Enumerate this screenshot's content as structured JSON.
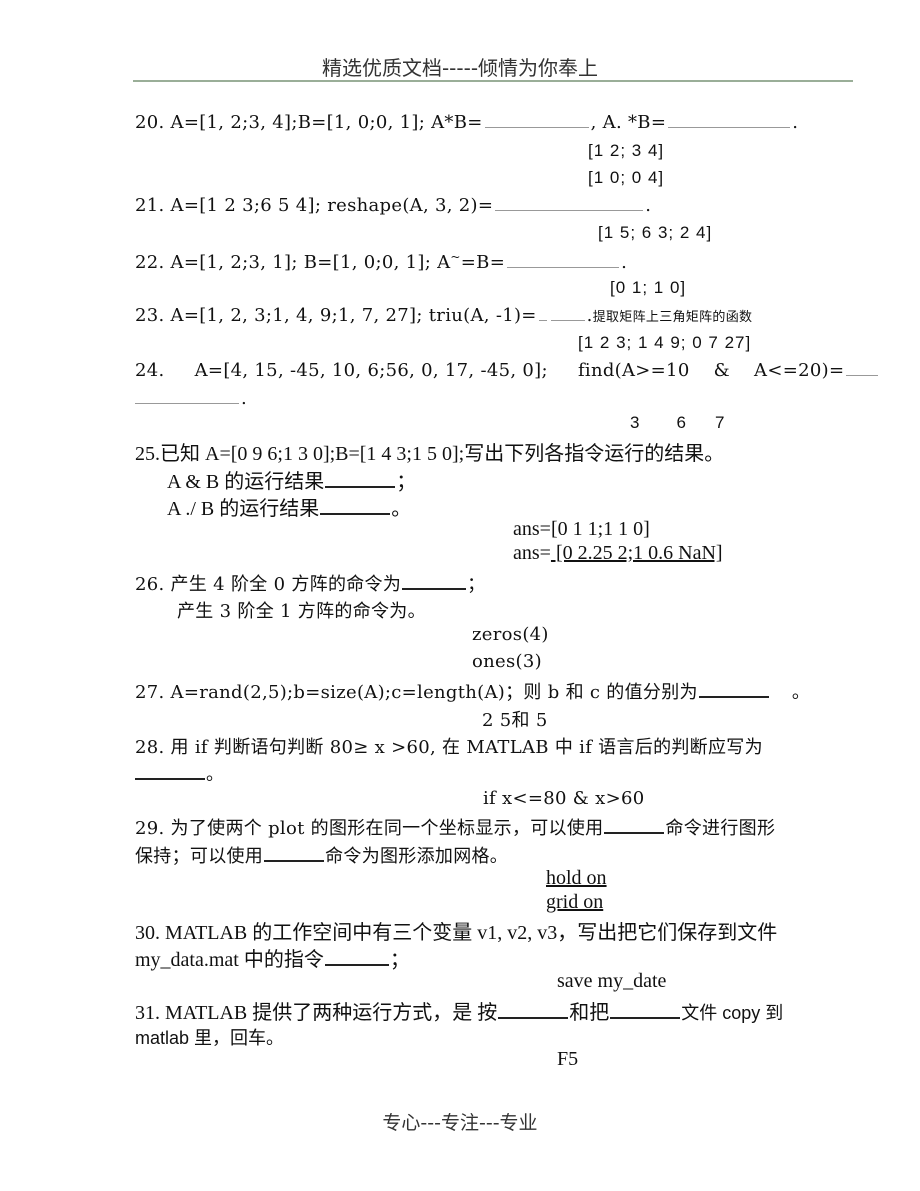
{
  "header": {
    "title": "精选优质文档-----倾情为你奉上"
  },
  "footer": {
    "text": "专心---专注---专业"
  },
  "questions": {
    "q20": {
      "prefix": "20. A=[1, 2;3, 4];B=[1, 0;0, 1]; A*B=",
      "middle": ", A. *B=",
      "suffix": ".",
      "answers": [
        "[1 2; 3 4]",
        "[1 0; 0 4]"
      ]
    },
    "q21": {
      "prefix": "21.  A=[1  2  3;6  5  4]; reshape(A, 3, 2)=",
      "suffix": ".",
      "answer": "[1 5; 6 3; 2 4]"
    },
    "q22": {
      "prefix": "22.  A=[1, 2;3, 1]; B=[1, 0;0, 1]; A",
      "tilde": "~",
      "mid": "=B=",
      "suffix": ".",
      "answer": "[0 1; 1 0]"
    },
    "q23": {
      "prefix": "23.  A=[1, 2, 3;1, 4, 9;1, 7, 27]; triu(A, -1)=",
      "suffix": ".",
      "note": "提取矩阵上三角矩阵的函数",
      "answer": "[1 2 3; 1 4 9; 0 7 27]"
    },
    "q24": {
      "prefix": "24.     A=[4, 15, -45, 10, 6;56, 0, 17, -45, 0];     find(A>=10    &    A<=20)=",
      "suffix": ".",
      "answer": [
        "3",
        "6",
        "7"
      ]
    },
    "q25": {
      "prompt": "25.已知 A=[0 9 6;1 3 0];B=[1 4 3;1 5 0];写出下列各指令运行的结果。",
      "line1": "A & B  的运行结果",
      "line1_end": "；",
      "line2": "A ./ B  的运行结果",
      "line2_end": "。",
      "answer1": "ans=[0 1 1;1 1 0]",
      "answer2_label": "ans=",
      "answer2_value": " [0 2.25 2;1 0.6 NaN]"
    },
    "q26": {
      "line1": "26.  产生 4 阶全 0 方阵的命令为",
      "line1_end": "；",
      "line2": "产生 3 阶全 1 方阵的命令为。",
      "answers": [
        "zeros(4)",
        "ones(3)"
      ]
    },
    "q27": {
      "prefix": "27.  A=rand(2,5);b=size(A);c=length(A)；则 b 和 c 的值分别为",
      "suffix": "。",
      "answer": "2 5和 5"
    },
    "q28": {
      "line1": "28.  用 if 判断语句判断 80≥  x  >60, 在 MATLAB 中 if 语言后的判断应写为",
      "line2_end": "。",
      "answer": "if x<=80 & x>60"
    },
    "q29": {
      "line1_a": "29. 为了使两个 plot 的图形在同一个坐标显示，可以使用",
      "line1_b": "命令进行图形",
      "line2_a": "保持；可以使用",
      "line2_b": "命令为图形添加网格。",
      "answers": [
        "hold on",
        "grid on"
      ]
    },
    "q30": {
      "line1": "30. MATLAB 的工作空间中有三个变量 v1, v2, v3，写出把它们保存到文件",
      "line2": "my_data.mat 中的指令",
      "line2_end": "；",
      "answer": "save my_date"
    },
    "q31": {
      "line1_a": "31. MATLAB 提供了两种运行方式，是 按",
      "line1_b": "和把",
      "line1_c": "文件 copy 到",
      "line2": "matlab 里，回车。",
      "answer": "F5"
    }
  }
}
